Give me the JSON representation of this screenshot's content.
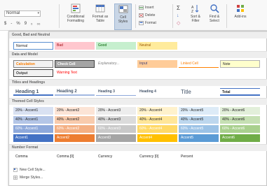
{
  "ribbon": {
    "font_name": "Normal",
    "number_format_symbols": [
      "$",
      "-",
      "%",
      "9",
      "₀",
      "₀₀"
    ],
    "buttons": {
      "conditional_formatting": "Conditional Formatting",
      "format_as_table": "Format as Table",
      "cell_styles": "Cell Styles",
      "insert": "Insert",
      "delete": "Delete",
      "format": "Format",
      "autosum": "Σ",
      "fill": "↓",
      "clear": "◇",
      "sort_filter": "Sort & Filter",
      "find_select": "Find & Select",
      "add_ins": "Add-ins"
    }
  },
  "gallery": {
    "sections": {
      "good_bad": "Good, Bad and Neutral",
      "data_model": "Data and Model",
      "titles": "Titles and Headings",
      "themed": "Themed Cell Styles",
      "number_format": "Number Format"
    },
    "good_bad": [
      "Normal",
      "Bad",
      "Good",
      "Neutral"
    ],
    "data_model_row1": [
      "Calculation",
      "Check Cell",
      "Explanatory...",
      "Input",
      "Linked Cell",
      "Note"
    ],
    "data_model_row2": [
      "Output",
      "Warning Text"
    ],
    "titles": [
      "Heading 1",
      "Heading 2",
      "Heading 3",
      "Heading 4",
      "Title",
      "Total"
    ],
    "themed_20": [
      "20% - Accent1",
      "20% - Accent2",
      "20% - Accent3",
      "20% - Accent4",
      "20% - Accent5",
      "20% - Accent6"
    ],
    "themed_40": [
      "40% - Accent1",
      "40% - Accent2",
      "40% - Accent3",
      "40% - Accent4",
      "40% - Accent5",
      "40% - Accent6"
    ],
    "themed_60": [
      "60% - Accent1",
      "60% - Accent2",
      "60% - Accent3",
      "60% - Accent4",
      "60% - Accent5",
      "60% - Accent6"
    ],
    "themed_accent": [
      "Accent1",
      "Accent2",
      "Accent3",
      "Accent4",
      "Accent5",
      "Accent6"
    ],
    "number_format": [
      "Comma",
      "Comma [0]",
      "Currency",
      "Currency [0]",
      "Percent"
    ],
    "new_style": "New Cell Style...",
    "merge_styles": "Merge Styles..."
  },
  "colors": {
    "accent1": "#4472c4",
    "accent2": "#ed7d31",
    "accent3": "#a5a5a5",
    "accent4": "#ffc000",
    "accent5": "#5b9bd5",
    "accent6": "#70ad47",
    "bad_bg": "#ffc7ce",
    "good_bg": "#c6efce",
    "neutral_bg": "#ffeb9c"
  }
}
